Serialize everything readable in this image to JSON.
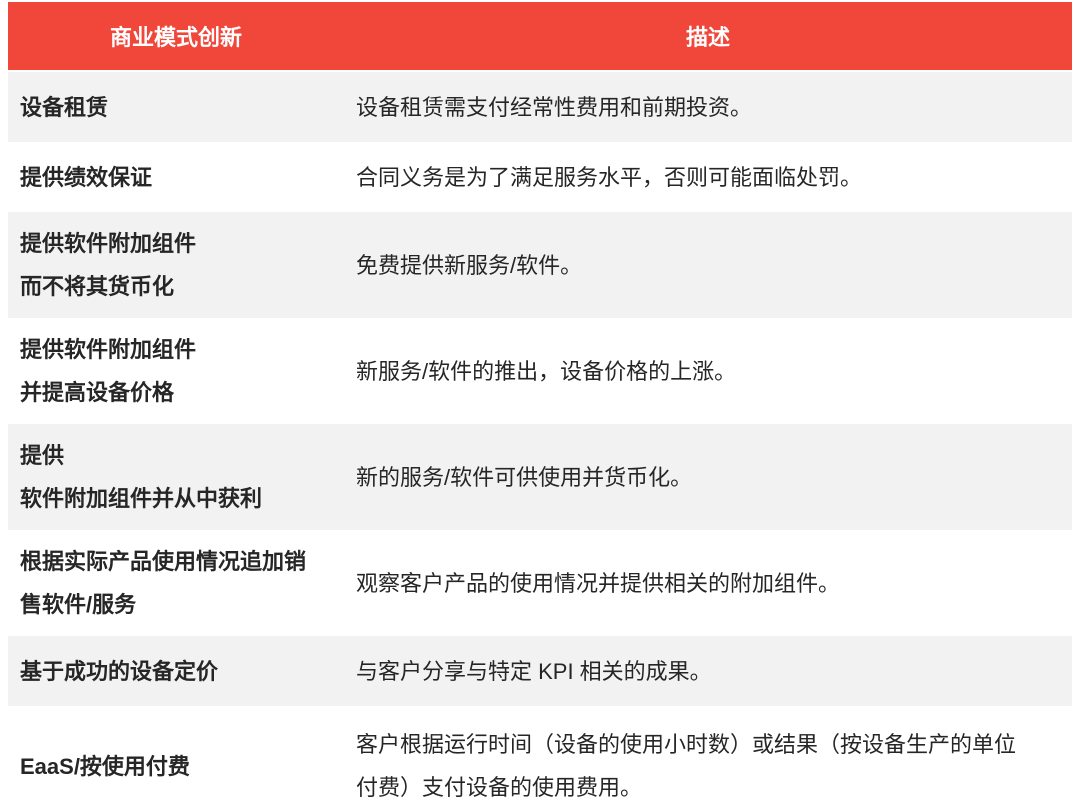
{
  "colors": {
    "header_bg": "#F1463A",
    "header_text": "#FFFFFF",
    "row_alt_bg": "#F2F2F2",
    "row_bg": "#FFFFFF",
    "text": "#262626"
  },
  "table": {
    "header": {
      "model": "商业模式创新",
      "description": "描述"
    },
    "rows": [
      {
        "model": [
          "设备租赁"
        ],
        "description": [
          "设备租赁需支付经常性费用和前期投资。"
        ]
      },
      {
        "model": [
          "提供绩效保证"
        ],
        "description": [
          "合同义务是为了满足服务水平，否则可能面临处罚。"
        ]
      },
      {
        "model": [
          "提供软件附加组件",
          "而不将其货币化"
        ],
        "description": [
          "免费提供新服务/软件。"
        ]
      },
      {
        "model": [
          "提供软件附加组件",
          "并提高设备价格"
        ],
        "description": [
          "新服务/软件的推出，设备价格的上涨。"
        ]
      },
      {
        "model": [
          "提供",
          "软件附加组件并从中获利"
        ],
        "description": [
          "新的服务/软件可供使用并货币化。"
        ]
      },
      {
        "model": [
          "根据实际产品使用情况追加销",
          "售软件/服务"
        ],
        "description": [
          "观察客户产品的使用情况并提供相关的附加组件。"
        ]
      },
      {
        "model": [
          "基于成功的设备定价"
        ],
        "description": [
          "与客户分享与特定 KPI 相关的成果。"
        ]
      },
      {
        "model": [
          "EaaS/按使用付费"
        ],
        "description": [
          "客户根据运行时间（设备的使用小时数）或结果（按设备生产的单位",
          "付费）支付设备的使用费用。"
        ]
      }
    ]
  }
}
